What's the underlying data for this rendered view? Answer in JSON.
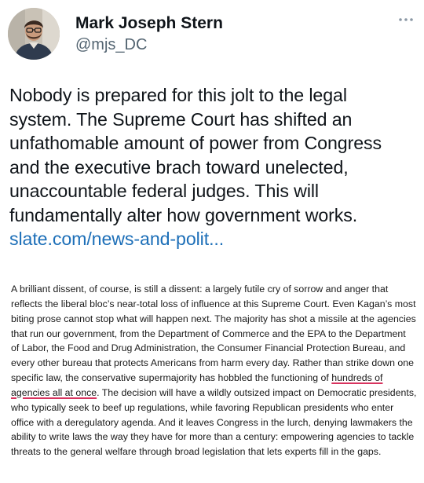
{
  "author": {
    "name": "Mark Joseph Stern",
    "handle": "@mjs_DC"
  },
  "icons": {
    "more": "more-horizontal-icon",
    "avatar": "profile-photo"
  },
  "colors": {
    "link": "#1d6fb8",
    "handle": "#536471",
    "underline": "#d8345f"
  },
  "tweet": {
    "lines": [
      "Nobody is prepared for this jolt to the legal",
      "system. The Supreme Court has shifted an",
      "unfathomable amount of power from Congress",
      "and the executive brach toward unelected,",
      "unaccountable federal judges. This will",
      "fundamentally alter how government works."
    ],
    "link": "slate.com/news-and-polit..."
  },
  "excerpt": {
    "lines": [
      "A brilliant dissent, of course, is still a dissent: a largely futile cry of sorrow and anger that",
      "reflects the liberal bloc’s near-total loss of influence at this Supreme Court. Even Kagan’s most",
      "biting prose cannot stop what will happen next. The majority has shot a missile at the agencies",
      "that run our government, from the Department of Commerce and the EPA to the Department",
      "of Labor, the Food and Drug Administration, the Consumer Financial Protection Bureau, and",
      "every other bureau that protects Americans from harm every day. Rather than strike down one"
    ],
    "line7_before": "specific law, the conservative supermajority has hobbled the functioning of ",
    "line7_highlight": "hundreds of",
    "line8_highlight": "agencies all at once",
    "line8_after": ". The decision will have a wildly outsized impact on Democratic presidents,",
    "lines_after": [
      "who typically seek to beef up regulations, while favoring Republican presidents who enter",
      "office with a deregulatory agenda. And it leaves Congress in the lurch, denying lawmakers the",
      "ability to write laws the way they have for more than a century: empowering agencies to tackle",
      "threats to the general welfare through broad legislation that lets experts fill in the gaps."
    ]
  }
}
